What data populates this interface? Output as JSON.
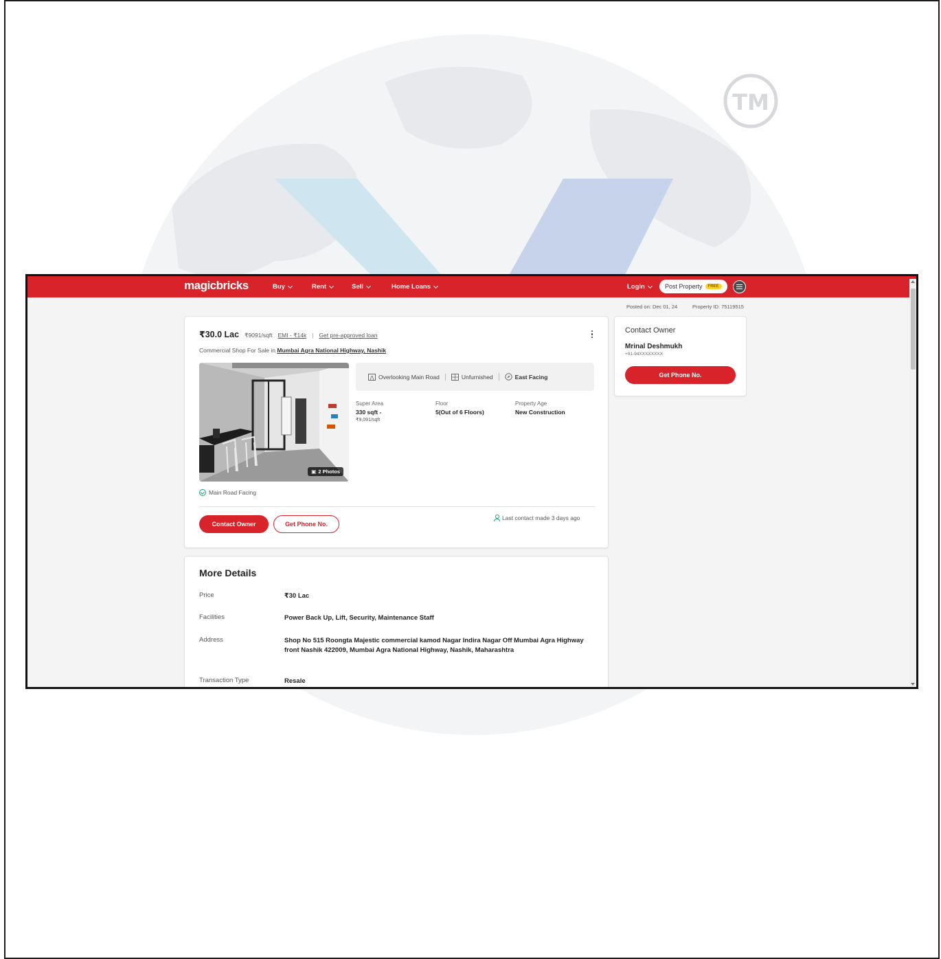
{
  "watermark": {
    "tm_mark": "TM"
  },
  "header": {
    "logo": "magicbricks",
    "nav": [
      {
        "label": "Buy"
      },
      {
        "label": "Rent"
      },
      {
        "label": "Sell"
      },
      {
        "label": "Home Loans"
      }
    ],
    "login": "Login",
    "post_property": "Post Property",
    "post_property_badge": "FREE"
  },
  "meta": {
    "posted_on": "Posted on: Dec 01, 24",
    "property_id": "Property ID: 75119515"
  },
  "listing": {
    "price": "₹30.0 Lac",
    "price_per_sqft": "₹9091/sqft",
    "emi": "EMI - ₹14k",
    "separator": "|",
    "loan_link": "Get pre-approved loan",
    "subtitle_prefix": "Commercial Shop For Sale in",
    "location": "Mumbai Agra National Highway, Nashik",
    "photos_badge": "2 Photos",
    "features": [
      {
        "icon": "road-view-icon",
        "label": "Overlooking Main Road"
      },
      {
        "icon": "furniture-icon",
        "label": "Unfurnished"
      },
      {
        "icon": "compass-icon",
        "label": "East Facing"
      }
    ],
    "attributes": {
      "super_area_label": "Super Area",
      "super_area_value": "330 sqft -",
      "super_area_sub": "₹9,091/sqft",
      "floor_label": "Floor",
      "floor_value": "5(Out of 6 Floors)",
      "age_label": "Property Age",
      "age_value": "New Construction"
    },
    "highlight": "Main Road Facing",
    "contact_owner_btn": "Contact Owner",
    "get_phone_btn": "Get Phone No.",
    "last_contact": "Last contact made 3 days ago"
  },
  "contact_card": {
    "title": "Contact Owner",
    "owner_name": "Mrinal Deshmukh",
    "owner_phone": "+91-94XXXXXXXX",
    "button": "Get Phone No."
  },
  "more_details": {
    "title": "More Details",
    "rows": [
      {
        "label": "Price",
        "value": "₹30 Lac"
      },
      {
        "label": "Facilities",
        "value": "Power Back Up, Lift, Security, Maintenance Staff"
      },
      {
        "label": "Address",
        "value": "Shop No 515 Roongta Majestic commercial kamod Nagar Indira Nagar Off Mumbai Agra Highway front Nashik 422009, Mumbai Agra National Highway, Nashik, Maharashtra"
      },
      {
        "label": "Transaction Type",
        "value": "Resale"
      }
    ]
  },
  "colors": {
    "brand_red": "#d8232a",
    "accent_green": "#0ea47a",
    "badge_yellow": "#ffd12a"
  }
}
